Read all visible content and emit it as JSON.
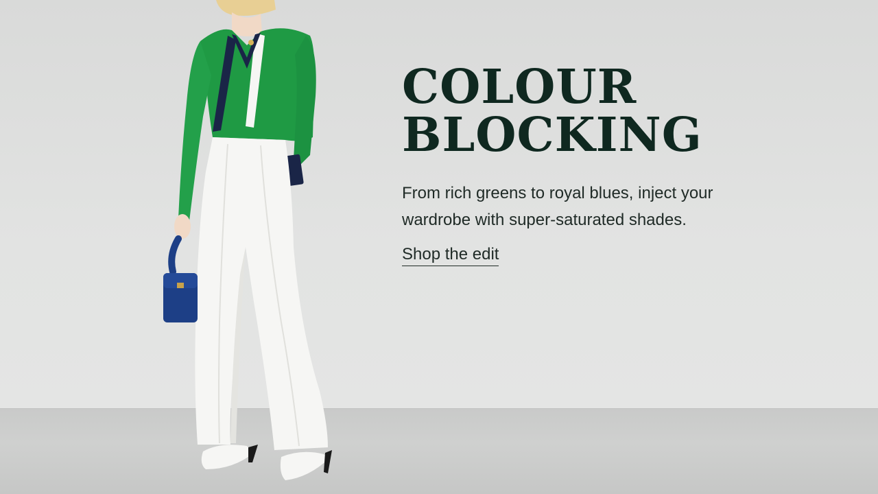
{
  "banner": {
    "headline_line1": "COLOUR",
    "headline_line2": "BLOCKING",
    "subtext": "From rich greens to royal blues, inject your wardrobe with super-saturated shades.",
    "cta_label": "Shop the edit"
  },
  "colors": {
    "wall": "#dfe0df",
    "floor": "#cbcccb",
    "headline": "#0f2820",
    "body_text": "#1f2a26",
    "knit_green": "#1f9a44",
    "trousers_white": "#f6f6f4",
    "bag_blue": "#1d3f86",
    "navy_tie": "#1a2547"
  }
}
